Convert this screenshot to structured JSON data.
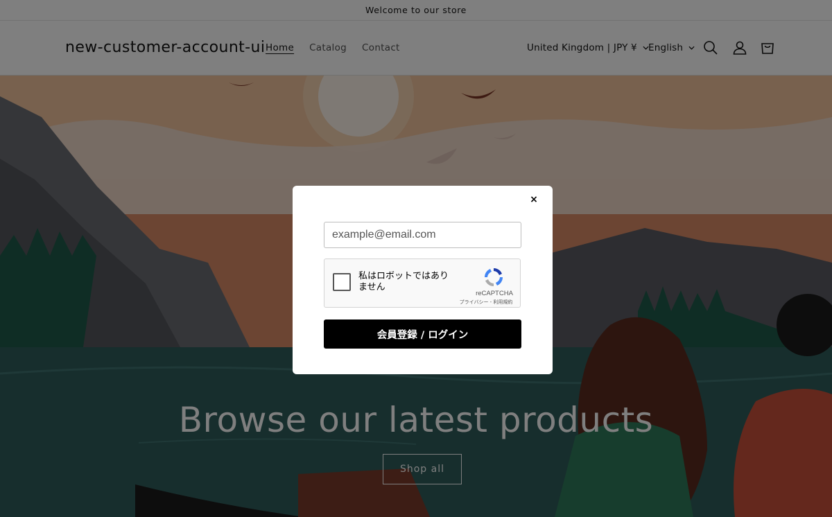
{
  "announcement": "Welcome to our store",
  "header": {
    "logo": "new-customer-account-ui",
    "nav": [
      "Home",
      "Catalog",
      "Contact"
    ],
    "country_selector": "United Kingdom | JPY ¥",
    "language_selector": "English",
    "icons": [
      "search-icon",
      "account-icon",
      "cart-icon"
    ]
  },
  "hero": {
    "title": "Browse our latest products",
    "button": "Shop all"
  },
  "modal": {
    "close": "×",
    "email_placeholder": "example@email.com",
    "recaptcha": {
      "checkbox_label": "私はロボットではありません",
      "brand": "reCAPTCHA",
      "links": "プライバシー - 利用規約"
    },
    "submit": "会員登録 / ログイン"
  },
  "colors": {
    "overlay": "rgba(0,0,0,0.5)",
    "button_bg": "#000000",
    "hero_sky": "#e8b48a",
    "hero_water": "#2f5c5a"
  }
}
